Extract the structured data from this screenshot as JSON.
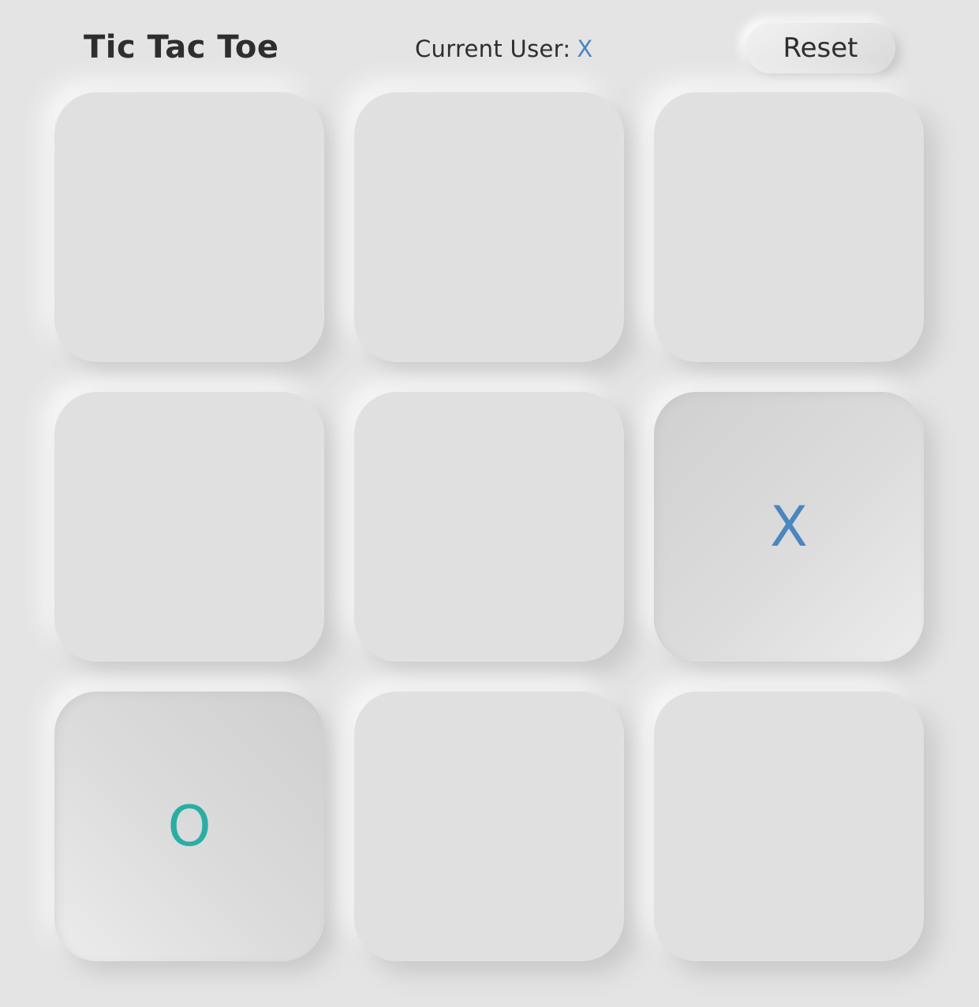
{
  "header": {
    "title": "Tic Tac Toe",
    "current_user_label": "Current User:",
    "current_user_value": "X",
    "reset_label": "Reset"
  },
  "colors": {
    "x_mark": "#4a86c0",
    "o_mark": "#2aaea4",
    "background": "#e4e4e4"
  },
  "board": {
    "cells": [
      "",
      "",
      "",
      "",
      "",
      "X",
      "O",
      "",
      ""
    ]
  }
}
